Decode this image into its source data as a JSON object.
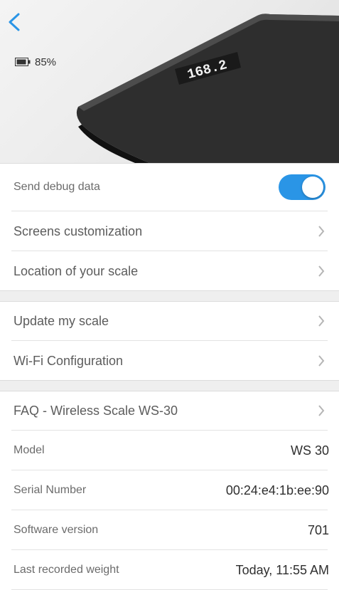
{
  "header": {
    "back_icon": "chevron-left-icon",
    "battery_icon": "battery-icon",
    "battery_percent": "85%",
    "scale_display": "168.2",
    "accent_color": "#2a95e6"
  },
  "settings": {
    "send_debug_label": "Send debug data",
    "send_debug_enabled": true,
    "screens_customization": "Screens customization",
    "location_of_scale": "Location of your scale"
  },
  "update": {
    "update_my_scale": "Update my scale",
    "wifi_configuration": "Wi-Fi Configuration"
  },
  "info": {
    "faq": "FAQ - Wireless Scale WS-30",
    "model_label": "Model",
    "model_value": "WS 30",
    "serial_label": "Serial Number",
    "serial_value": "00:24:e4:1b:ee:90",
    "software_label": "Software version",
    "software_value": "701",
    "last_weight_label": "Last recorded weight",
    "last_weight_value": "Today, 11:55 AM"
  }
}
